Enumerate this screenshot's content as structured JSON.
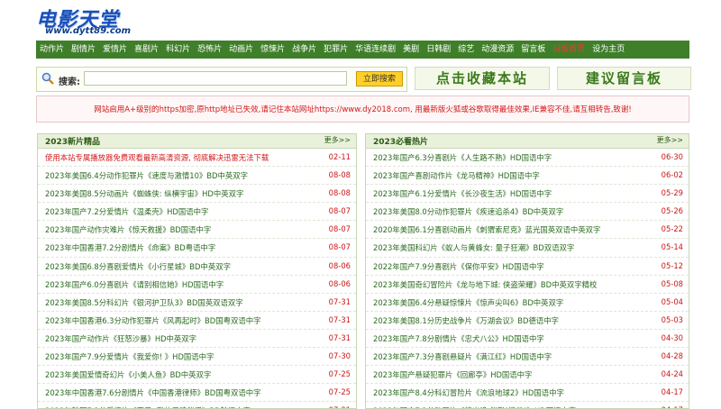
{
  "logo": {
    "text": "电影天堂",
    "sub": "www.dytt89.com"
  },
  "nav": [
    {
      "label": "动作片",
      "red": false
    },
    {
      "label": "剧情片",
      "red": false
    },
    {
      "label": "爱情片",
      "red": false
    },
    {
      "label": "喜剧片",
      "red": false
    },
    {
      "label": "科幻片",
      "red": false
    },
    {
      "label": "恐怖片",
      "red": false
    },
    {
      "label": "动画片",
      "red": false
    },
    {
      "label": "惊悚片",
      "red": false
    },
    {
      "label": "战争片",
      "red": false
    },
    {
      "label": "犯罪片",
      "red": false
    },
    {
      "label": "华语连续剧",
      "red": false
    },
    {
      "label": "美剧",
      "red": false
    },
    {
      "label": "日韩剧",
      "red": false
    },
    {
      "label": "综艺",
      "red": false
    },
    {
      "label": "动漫资源",
      "red": false
    },
    {
      "label": "留言板",
      "red": false
    },
    {
      "label": "旧版首页",
      "red": true
    },
    {
      "label": "设为主页",
      "red": false
    }
  ],
  "search": {
    "label": "搜索:",
    "placeholder": "",
    "button": "立即搜索"
  },
  "buttons": {
    "favorite": "点击收藏本站",
    "message": "建议留言板"
  },
  "notice": "网站启用A+级别的https加密,原http地址已失效,请记住本站网址https://www.dy2018.com, 用最新版火狐或谷歌取得最佳效果,IE兼容不佳,请互相转告,致谢!",
  "left": {
    "title": "2023新片精品",
    "more": "更多>>",
    "items": [
      {
        "title": "使用本站专属播放器免费观看最新高清资源, 彻底解决迅雷无法下载",
        "date": "02-11",
        "red": true
      },
      {
        "title": "2023年美国6.4分动作犯罪片《速度与激情10》BD中英双字",
        "date": "08-08"
      },
      {
        "title": "2023年美国8.5分动画片《蜘蛛侠: 纵横宇宙》HD中英双字",
        "date": "08-08"
      },
      {
        "title": "2023年国产7.2分爱情片《温柔壳》HD国语中字",
        "date": "08-07"
      },
      {
        "title": "2023年国产动作灾难片《惊天救援》BD国语中字",
        "date": "08-07"
      },
      {
        "title": "2023年中国香港7.2分剧情片《命案》BD粤语中字",
        "date": "08-07"
      },
      {
        "title": "2023年美国6.8分喜剧爱情片《小行星城》BD中英双字",
        "date": "08-06"
      },
      {
        "title": "2023年国产6.0分喜剧片《请别相信她》HD国语中字",
        "date": "08-06"
      },
      {
        "title": "2023年美国8.5分科幻片《银河护卫队3》BD国英双语双字",
        "date": "07-31"
      },
      {
        "title": "2023年中国香港6.3分动作犯罪片《风再起时》BD国粤双语中字",
        "date": "07-31"
      },
      {
        "title": "2023年国产动作片《狂怒沙暴》HD中英双字",
        "date": "07-31"
      },
      {
        "title": "2023年国产7.9分爱情片《我爱你! 》HD国语中字",
        "date": "07-30"
      },
      {
        "title": "2023年美国爱情奇幻片《小美人鱼》BD中英双字",
        "date": "07-25"
      },
      {
        "title": "2023年中国香港7.6分剧情片《中国香港律师》BD国粤双语中字",
        "date": "07-25"
      },
      {
        "title": "2023年韩国7.3分爱情片《再见, 我的灵魂伴侣》BD韩语中字",
        "date": "07-21"
      }
    ]
  },
  "right": {
    "title": "2023必看热片",
    "more": "更多>>",
    "items": [
      {
        "title": "2023年国产6.3分喜剧片《人生路不熟》HD国语中字",
        "date": "06-30"
      },
      {
        "title": "2023年国产喜剧动作片《龙马精神》HD国语中字",
        "date": "06-02"
      },
      {
        "title": "2023年国产6.1分爱情片《长沙夜生活》HD国语中字",
        "date": "05-29"
      },
      {
        "title": "2023年美国8.0分动作犯罪片《疾速追杀4》BD中英双字",
        "date": "05-26"
      },
      {
        "title": "2020年美国6.1分喜剧动画片《刺猬索尼克》蓝光国英双语中英双字",
        "date": "05-22"
      },
      {
        "title": "2023年美国科幻片《蚁人与黄蜂女: 量子狂潮》BD双语双字",
        "date": "05-14"
      },
      {
        "title": "2022年国产7.9分喜剧片《保你平安》HD国语中字",
        "date": "05-12"
      },
      {
        "title": "2023年美国奇幻冒险片《龙与地下城: 侠盗荣耀》BD中英双字精校",
        "date": "05-08"
      },
      {
        "title": "2023年美国6.4分悬疑惊悚片《惊声尖叫6》BD中英双字",
        "date": "05-04"
      },
      {
        "title": "2023年美国8.1分历史战争片《万湖会议》BD德语中字",
        "date": "05-03"
      },
      {
        "title": "2023年国产7.8分剧情片《忠犬八公》HD国语中字",
        "date": "04-30"
      },
      {
        "title": "2023年国产7.3分喜剧悬疑片《满江红》HD国语中字",
        "date": "04-28"
      },
      {
        "title": "2023年国产悬疑犯罪片《回廊亭》HD国语中字",
        "date": "04-24"
      },
      {
        "title": "2023年国产8.4分科幻冒险片《流浪地球2》HD国语中字",
        "date": "04-17"
      },
      {
        "title": "2023年国产7.2分动画片《熊出没·伴我\"熊芯\"》HD国语中字",
        "date": "04-17"
      }
    ]
  }
}
